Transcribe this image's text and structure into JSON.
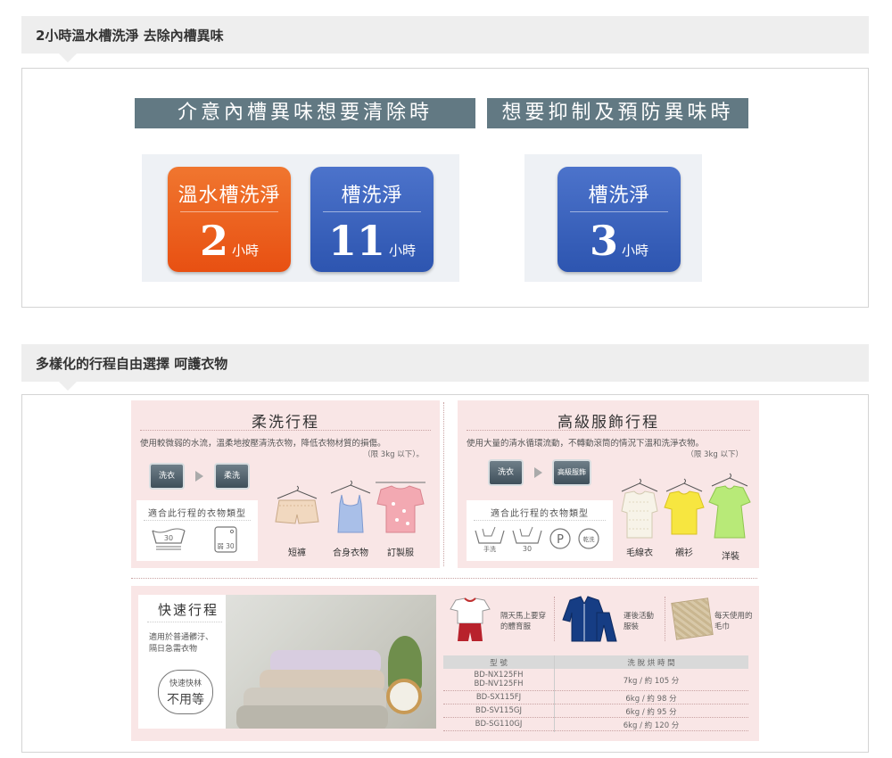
{
  "section1": {
    "title": "2小時溫水槽洗淨 去除內槽異味",
    "banner_left": "介意內槽異味想要清除時",
    "banner_right": "想要抑制及預防異味時",
    "tiles": [
      {
        "title": "溫水槽洗淨",
        "number": "2",
        "unit": "小時",
        "color": "#e85a1a"
      },
      {
        "title": "槽洗淨",
        "number": "11",
        "unit": "小時",
        "color": "#3a61bd"
      },
      {
        "title": "槽洗淨",
        "number": "3",
        "unit": "小時",
        "color": "#3a61bd"
      }
    ]
  },
  "section2": {
    "title": "多樣化的行程自由選擇 呵護衣物",
    "soft": {
      "title": "柔洗行程",
      "desc": "使用較微弱的水流，溫柔地按壓清洗衣物，降低衣物材質的損傷。",
      "limit": "（限 3kg 以下）。",
      "steps": [
        "洗衣",
        "柔洗"
      ],
      "care_title": "適合此行程的衣物類型",
      "care_icons": [
        "30",
        "弱 30"
      ],
      "clothes": [
        "短褲",
        "合身衣物",
        "訂製服"
      ]
    },
    "premium": {
      "title": "高級服飾行程",
      "desc": "使用大量的清水循環流動，不轉動滾筒的情況下溫和洗淨衣物。",
      "limit": "（限 3kg 以下）",
      "steps": [
        "洗衣",
        "高級服飾"
      ],
      "care_title": "適合此行程的衣物類型",
      "care_icons": [
        "手洗",
        "30",
        "P",
        "乾洗"
      ],
      "clothes": [
        "毛線衣",
        "襯衫",
        "洋裝"
      ]
    },
    "quick": {
      "title": "快速行程",
      "desc_line1": "適用於普通髒汙、",
      "desc_line2": "隔日急需衣物",
      "badge_line1": "快速快林",
      "badge_line2": "不用等",
      "items": [
        "隔天馬上要穿的體育服",
        "運後活動服裝",
        "每天使用的毛巾"
      ],
      "table_headers": [
        "型 號",
        "洗 脫 烘 時 間"
      ],
      "table_rows": [
        {
          "model": "BD-NX125FH",
          "model2": "BD-NV125FH",
          "time": "7kg / 約 105 分"
        },
        {
          "model": "BD-SX115FJ",
          "model2": "",
          "time": "6kg / 約 98 分"
        },
        {
          "model": "BD-SV115GJ",
          "model2": "",
          "time": "6kg / 約 95 分"
        },
        {
          "model": "BD-SG110GJ",
          "model2": "",
          "time": "6kg / 約 120 分"
        }
      ]
    }
  }
}
